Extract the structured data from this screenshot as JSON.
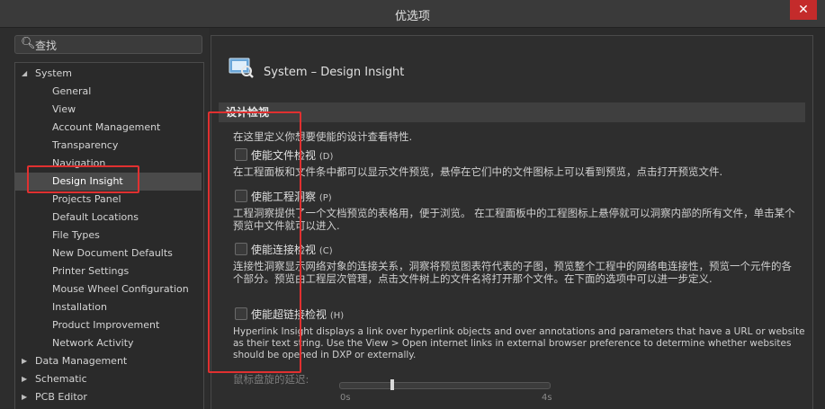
{
  "window": {
    "title": "优选项",
    "close_label": "✕"
  },
  "search": {
    "label": "查找",
    "icon": "magnifier-icon"
  },
  "tree": {
    "system": "System",
    "items": [
      "General",
      "View",
      "Account Management",
      "Transparency",
      "Navigation",
      "Design Insight",
      "Projects Panel",
      "Default Locations",
      "File Types",
      "New Document Defaults",
      "Printer Settings",
      "Mouse Wheel Configuration",
      "Installation",
      "Product Improvement",
      "Network Activity"
    ],
    "selected": "Design Insight",
    "groups": [
      "Data Management",
      "Schematic",
      "PCB Editor"
    ]
  },
  "page": {
    "title": "System – Design Insight",
    "section": "设计检视",
    "intro": "在这里定义你想要使能的设计查看特性.",
    "options": [
      {
        "label": "使能文件检视",
        "hotkey": "(D)",
        "desc": "在工程面板和文件条中都可以显示文件预览，悬停在它们中的文件图标上可以看到预览，点击打开预览文件."
      },
      {
        "label": "使能工程洞察",
        "hotkey": "(P)",
        "desc": "工程洞察提供了一个文档预览的表格用，便于浏览。 在工程面板中的工程图标上悬停就可以洞察内部的所有文件，单击某个预览中文件就可以进入."
      },
      {
        "label": "使能连接检视",
        "hotkey": "(C)",
        "desc": "连接性洞察显示网络对象的连接关系，洞察将预览图表符代表的子图，预览整个工程中的网络电连接性，预览一个元件的各个部分。预览由工程层次管理，点击文件树上的文件名将打开那个文件。在下面的选项中可以进一步定义."
      },
      {
        "label": "使能超链接检视",
        "hotkey": "(H)",
        "desc": "Hyperlink Insight displays a link over hyperlink objects and over annotations and parameters that have a URL or website as their text string. Use the View > Open internet links in external browser preference to determine whether websites should be opened in DXP or externally."
      }
    ],
    "slider": {
      "label": "鼠标盘旋的延迟:",
      "min_label": "0s",
      "max_label": "4s",
      "value_fraction": 0.25
    }
  },
  "colors": {
    "highlight": "#e03030",
    "selected_bg": "#4a4a4a",
    "close_bg": "#c42b2b"
  }
}
